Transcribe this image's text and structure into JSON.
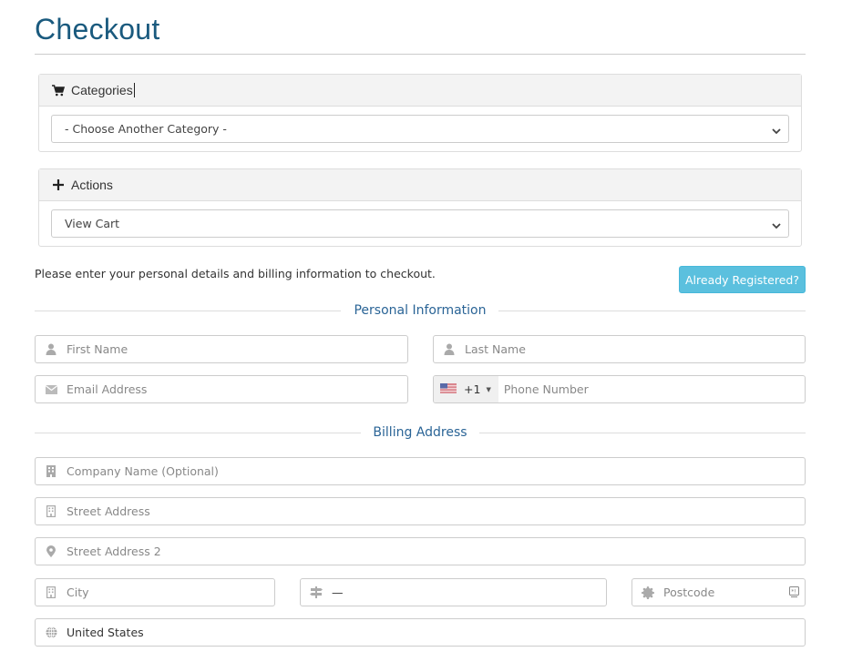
{
  "page": {
    "title": "Checkout"
  },
  "categories_panel": {
    "heading": "Categories",
    "icon": "shopping-cart-icon",
    "select_value": "- Choose Another Category -"
  },
  "actions_panel": {
    "heading": "Actions",
    "icon": "plus-icon",
    "select_value": "View Cart"
  },
  "intro_text": "Please enter your personal details and billing information to checkout.",
  "already_registered_button": "Already Registered?",
  "colors": {
    "title": "#1a5a7e",
    "section_heading": "#2a6496",
    "info_button": "#5bc0de"
  },
  "personal_information": {
    "heading": "Personal Information",
    "first_name": {
      "placeholder": "First Name",
      "icon": "user-icon"
    },
    "last_name": {
      "placeholder": "Last Name",
      "icon": "user-icon"
    },
    "email": {
      "placeholder": "Email Address",
      "icon": "envelope-icon"
    },
    "phone": {
      "country_flag": "us-flag-icon",
      "dial_code": "+1",
      "placeholder": "Phone Number"
    }
  },
  "billing_address": {
    "heading": "Billing Address",
    "company": {
      "placeholder": "Company Name (Optional)",
      "icon": "building-icon"
    },
    "street": {
      "placeholder": "Street Address",
      "icon": "building-outline-icon"
    },
    "street2": {
      "placeholder": "Street Address 2",
      "icon": "map-marker-icon"
    },
    "city": {
      "placeholder": "City",
      "icon": "building-outline-icon"
    },
    "state": {
      "value": "—",
      "icon": "signpost-icon"
    },
    "postcode": {
      "placeholder": "Postcode",
      "icon": "certificate-icon"
    },
    "country": {
      "value": "United States",
      "icon": "globe-icon"
    }
  }
}
